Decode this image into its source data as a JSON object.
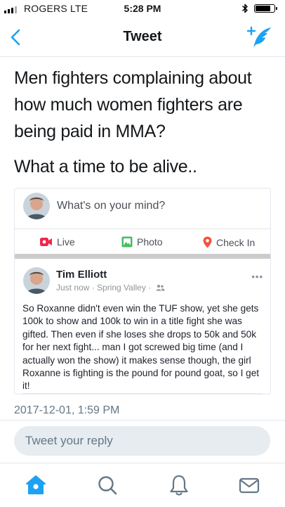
{
  "status_bar": {
    "carrier": "ROGERS  LTE",
    "time": "5:28 PM",
    "battery_level": 0.85,
    "signal_bars": 3,
    "icons": [
      "bluetooth-icon",
      "battery-icon"
    ]
  },
  "nav": {
    "title": "Tweet",
    "back_icon": "chevron-left-icon",
    "compose_icon": "compose-tweet-icon"
  },
  "tweet": {
    "paragraphs": [
      "Men fighters complaining about\nhow much women fighters are\nbeing paid in MMA?",
      "What a time to be alive.."
    ],
    "timestamp": "2017-12-01, 1:59 PM"
  },
  "embedded_post": {
    "composer_prompt": "What's on your mind?",
    "actions": [
      {
        "label": "Live",
        "icon": "live-video-icon"
      },
      {
        "label": "Photo",
        "icon": "photo-icon"
      },
      {
        "label": "Check In",
        "icon": "location-pin-icon"
      }
    ],
    "author": "Tim Elliott",
    "meta": "Just now · Spring Valley · ",
    "audience_icon": "friends-icon",
    "more_icon": "more-dots-icon",
    "body": "So Roxanne didn't even win the TUF show, yet she gets 100k to show and 100k to win in a title fight she was gifted. Then even if she loses she drops to 50k and 50k for her next fight... man I got screwed big time (and I actually won the show) it makes sense though, the girl Roxanne is fighting is the pound for pound goat, so I get it!"
  },
  "reply": {
    "placeholder": "Tweet your reply"
  },
  "tab_bar": {
    "tabs": [
      "home-icon",
      "search-icon",
      "notifications-icon",
      "messages-icon"
    ],
    "active": "home-icon"
  },
  "colors": {
    "twitter_blue": "#1da1f2",
    "text": "#14171a",
    "secondary_text": "#657786",
    "reply_bg": "#e6ecf0",
    "live_red": "#f02849",
    "photo_green": "#45bd62",
    "checkin_red": "#f5533d"
  }
}
